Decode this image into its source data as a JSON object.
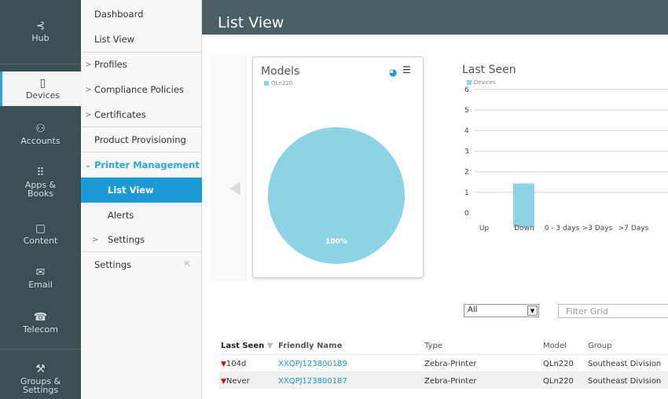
{
  "rail": {
    "items": [
      {
        "icon": "hub-icon",
        "glyph": "⊰",
        "label": "Hub"
      },
      {
        "icon": "device-icon",
        "glyph": "▯",
        "label": "Devices"
      },
      {
        "icon": "accounts-icon",
        "glyph": "⚇",
        "label": "Accounts"
      },
      {
        "icon": "apps-icon",
        "glyph": "⠿",
        "label": "Apps &",
        "label2": "Books"
      },
      {
        "icon": "content-icon",
        "glyph": "▢",
        "label": "Content"
      },
      {
        "icon": "email-icon",
        "glyph": "✉",
        "label": "Email"
      },
      {
        "icon": "telecom-icon",
        "glyph": "☎",
        "label": "Telecom"
      },
      {
        "icon": "groups-icon",
        "glyph": "⚒",
        "label": "Groups &",
        "label2": "Settings"
      }
    ]
  },
  "subnav": {
    "dashboard": "Dashboard",
    "list_view": "List View",
    "profiles": "Profiles",
    "compliance": "Compliance Policies",
    "certificates": "Certificates",
    "product_provisioning": "Product Provisioning",
    "printer_management": "Printer Management",
    "pm_list_view": "List View",
    "alerts": "Alerts",
    "settings_sub": "Settings",
    "settings": "Settings"
  },
  "header": {
    "title": "List View"
  },
  "models_card": {
    "title": "Models",
    "legend": "QLn220",
    "slice_label": "100%"
  },
  "last_seen": {
    "title": "Last Seen",
    "legend": "Devices"
  },
  "chart_data": [
    {
      "type": "pie",
      "title": "Models",
      "categories": [
        "QLn220"
      ],
      "values": [
        100
      ],
      "colors": [
        "#8dd2e7"
      ]
    },
    {
      "type": "bar",
      "title": "Last Seen",
      "categories": [
        "Up",
        "Down",
        "0 - 3 days",
        ">3 Days",
        ">7 Days"
      ],
      "series": [
        {
          "name": "Devices",
          "values": [
            0,
            2,
            0,
            0,
            0
          ]
        }
      ],
      "ylim": [
        0,
        6
      ],
      "yticks": [
        "0",
        "1",
        "2",
        "3",
        "4",
        "5",
        "6"
      ],
      "color": "#8dd2e7",
      "grid": true
    }
  ],
  "filter": {
    "select_value": "All",
    "placeholder": "Filter Grid"
  },
  "table": {
    "columns": [
      "Last Seen",
      "Friendly Name",
      "Type",
      "Model",
      "Group"
    ],
    "rows": [
      {
        "last_seen": "104d",
        "friendly_name": "XXQPJ123800189",
        "type": "Zebra-Printer",
        "model": "QLn220",
        "group": "Southeast Division"
      },
      {
        "last_seen": "Never",
        "friendly_name": "XXQPJ123800187",
        "type": "Zebra-Printer",
        "model": "QLn220",
        "group": "Southeast Division"
      }
    ]
  },
  "colors": {
    "rail": "#3d4e55",
    "header": "#4d5f66",
    "accent": "#1c9ad6",
    "bar": "#8dd2e7"
  }
}
